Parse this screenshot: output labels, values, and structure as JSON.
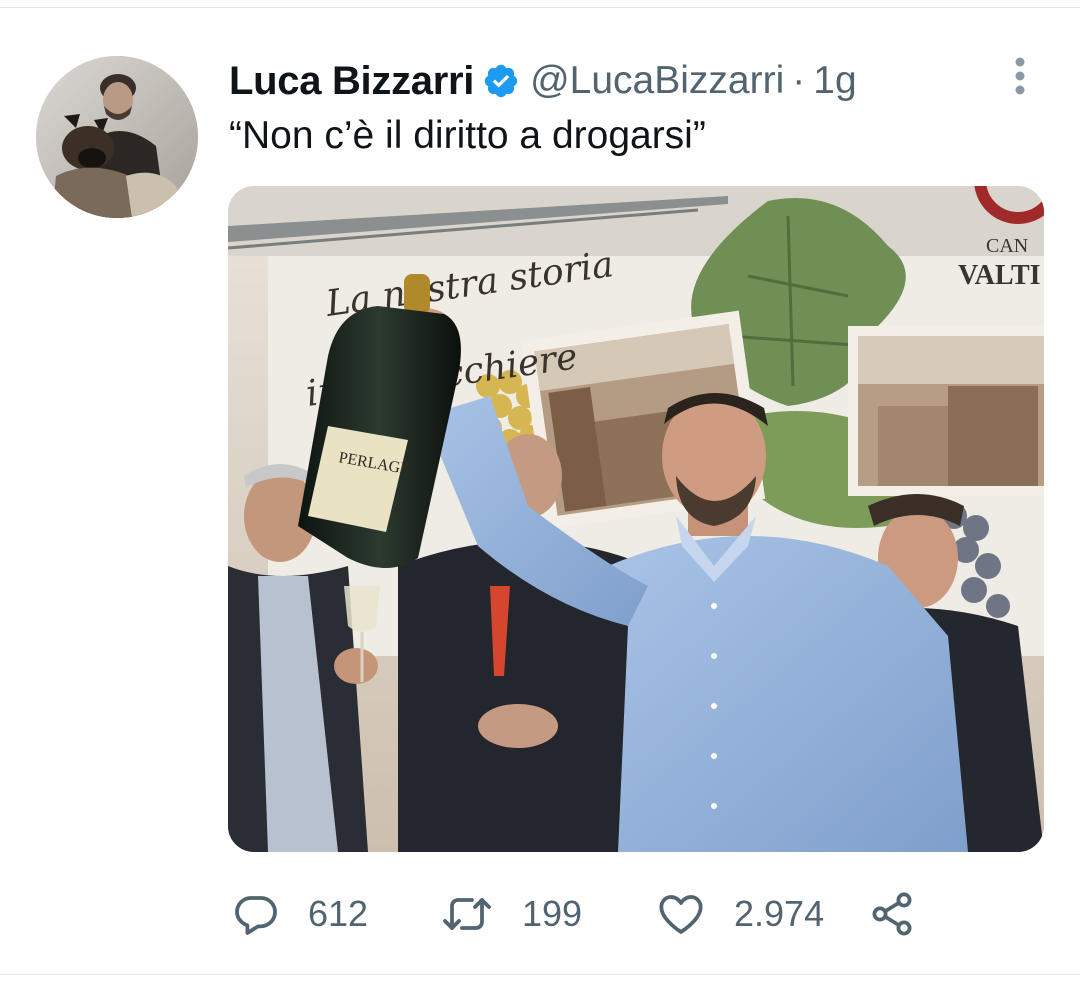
{
  "tweet": {
    "display_name": "Luca Bizzarri",
    "handle": "@LucaBizzarri",
    "separator": "·",
    "time": "1g",
    "text": "“Non c’è il diritto a drogarsi”",
    "verified": true,
    "verified_color": "#1d9bf0",
    "more_icon": "more-vertical-icon",
    "media": {
      "banner_line1": "La nostra storia",
      "banner_line2": "in un bicchiere",
      "brand_top": "CAN",
      "brand_bottom": "VALTI",
      "bottle_label": "PERLAGE"
    },
    "actions": {
      "reply": {
        "icon": "reply-icon",
        "count": "612"
      },
      "retweet": {
        "icon": "retweet-icon",
        "count": "199"
      },
      "like": {
        "icon": "heart-icon",
        "count": "2.974"
      },
      "share": {
        "icon": "share-icon"
      }
    }
  },
  "colors": {
    "text_primary": "#0f1419",
    "text_secondary": "#536471",
    "divider": "#e6e9ec"
  }
}
